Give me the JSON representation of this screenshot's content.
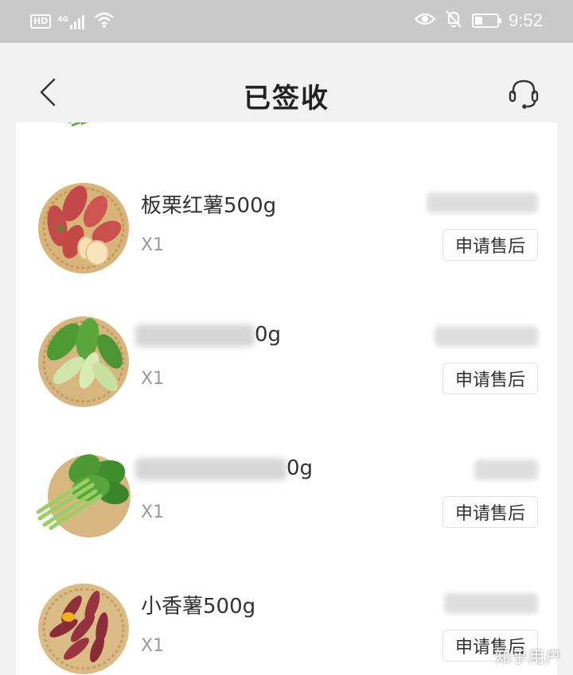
{
  "status_bar": {
    "hd_label": "HD",
    "network_label": "4G",
    "battery_level": 0.35,
    "time": "9:52"
  },
  "header": {
    "title": "已签收",
    "back_icon": "chevron-left-icon",
    "service_icon": "headset-icon"
  },
  "items": [
    {
      "name": "板栗红薯500g",
      "quantity": "X1",
      "after_sale_label": "申请售后",
      "image": "sweet-potato"
    },
    {
      "name_visible": "0g",
      "quantity": "X1",
      "after_sale_label": "申请售后",
      "image": "bok-choy"
    },
    {
      "name_visible": "0g",
      "quantity": "X1",
      "after_sale_label": "申请售后",
      "image": "leafy-greens"
    },
    {
      "name": "小香薯500g",
      "quantity": "X1",
      "after_sale_label": "申请售后",
      "image": "small-sweet-potatoes"
    }
  ],
  "watermark": "知乎用户",
  "colors": {
    "status_bar_bg": "#c9c9c9",
    "page_bg": "#f2f2f2",
    "card_bg": "#ffffff",
    "muted_text": "#999999"
  }
}
